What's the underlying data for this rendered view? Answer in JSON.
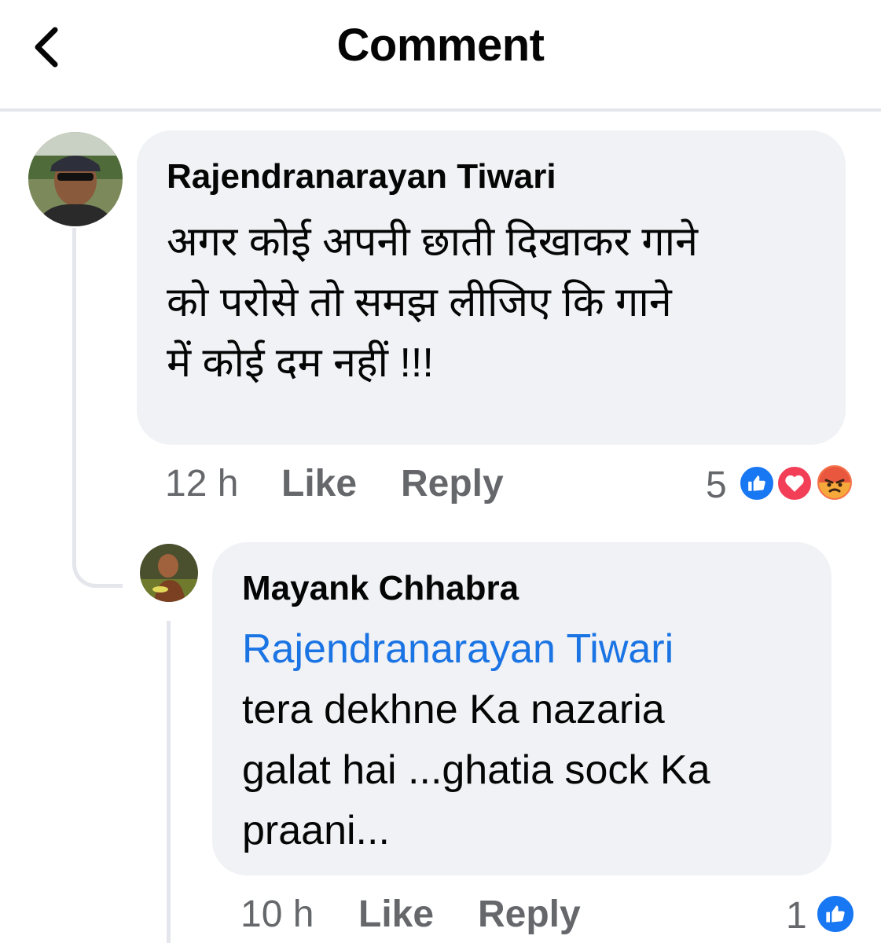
{
  "header": {
    "title": "Comment"
  },
  "comment": {
    "author": "Rajendranarayan Tiwari",
    "lines": [
      "अगर कोई अपनी छाती दिखाकर गाने",
      "को परोसे तो समझ लीजिए कि गाने",
      "में कोई दम नहीं !!!"
    ],
    "time": "12 h",
    "like_label": "Like",
    "reply_label": "Reply",
    "reaction_count": "5",
    "reactions": [
      "like-icon",
      "love-icon",
      "angry-icon"
    ]
  },
  "reply": {
    "author": "Mayank Chhabra",
    "mention": "Rajendranarayan Tiwari",
    "lines": [
      "tera dekhne Ka nazaria",
      "galat hai ...ghatia sock Ka",
      "praani..."
    ],
    "time": "10 h",
    "like_label": "Like",
    "reply_label": "Reply",
    "reaction_count": "1",
    "reactions": [
      "like-icon"
    ]
  },
  "colors": {
    "bubble": "#f0f2f5",
    "meta_text": "#65676b",
    "mention": "#1b74e4",
    "like": "#1877f2",
    "love": "#f33e58",
    "angry": "#f7714c"
  }
}
